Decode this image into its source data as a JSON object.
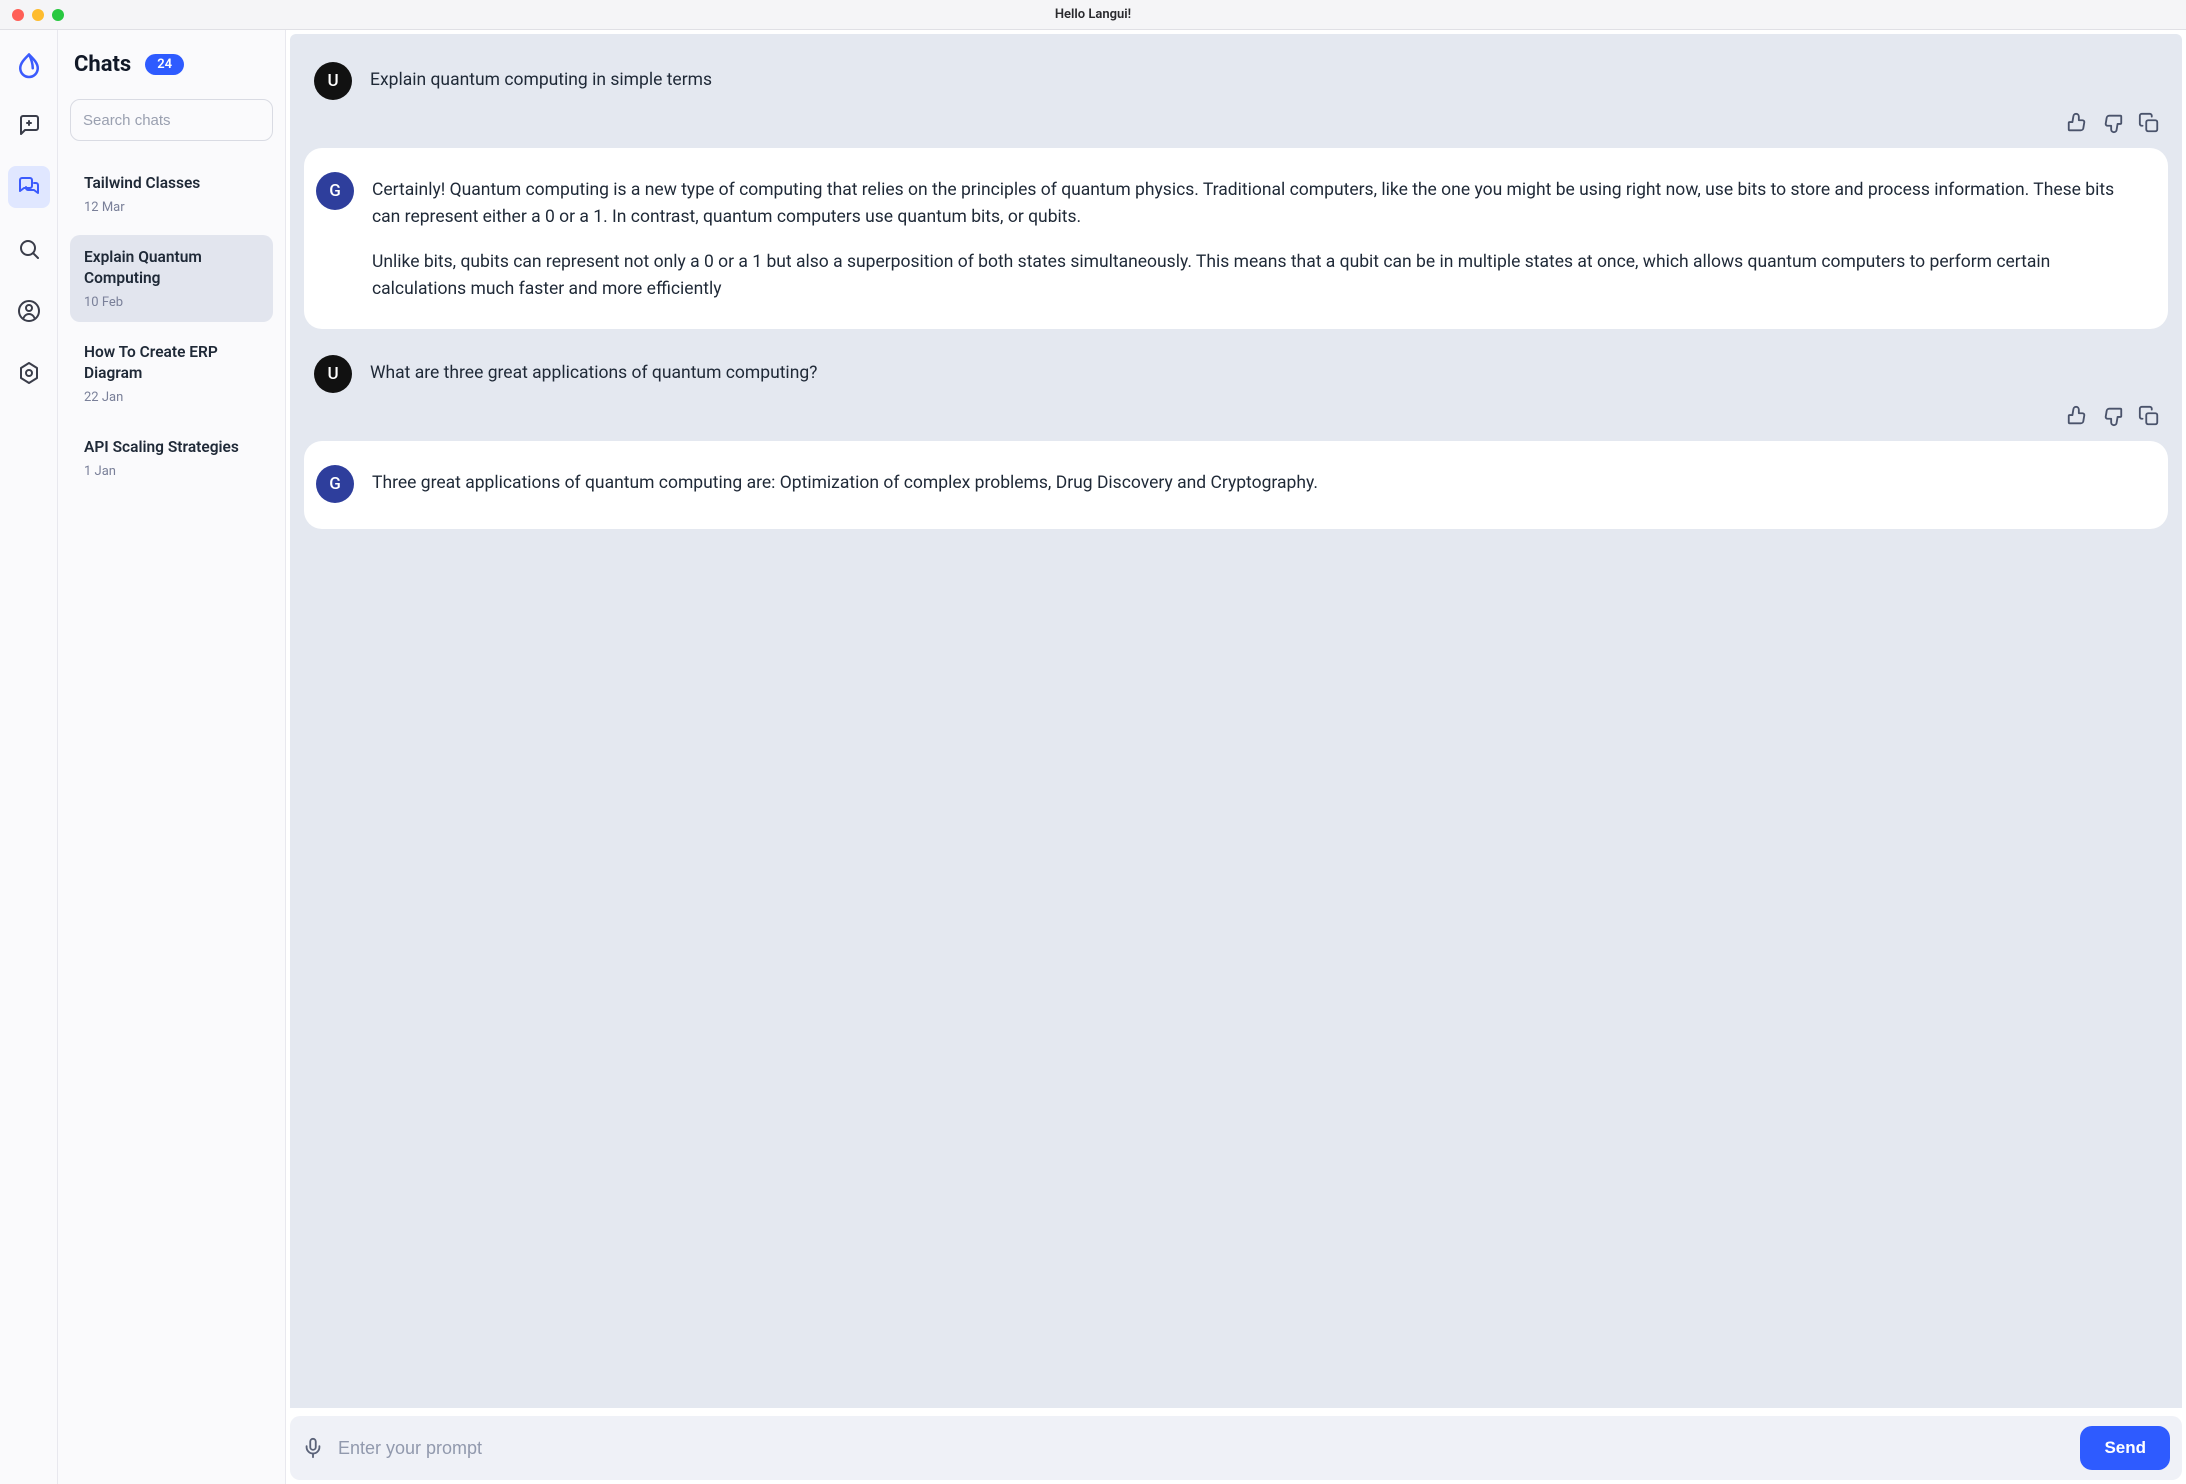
{
  "window": {
    "title": "Hello Langui!"
  },
  "sidebar": {
    "heading": "Chats",
    "badge": "24",
    "search_placeholder": "Search chats",
    "items": [
      {
        "title": "Tailwind Classes",
        "date": "12 Mar",
        "active": false
      },
      {
        "title": "Explain Quantum Computing",
        "date": "10 Feb",
        "active": true
      },
      {
        "title": "How To Create ERP Diagram",
        "date": "22 Jan",
        "active": false
      },
      {
        "title": "API Scaling Strategies",
        "date": "1 Jan",
        "active": false
      }
    ]
  },
  "conversation": [
    {
      "role": "user",
      "avatar": "U",
      "text": "Explain quantum computing in simple terms"
    },
    {
      "role": "assistant",
      "avatar": "G",
      "paragraphs": [
        "Certainly! Quantum computing is a new type of computing that relies on the principles of quantum physics. Traditional computers, like the one you might be using right now, use bits to store and process information. These bits can represent either a 0 or a 1. In contrast, quantum computers use quantum bits, or qubits.",
        "Unlike bits, qubits can represent not only a 0 or a 1 but also a superposition of both states simultaneously. This means that a qubit can be in multiple states at once, which allows quantum computers to perform certain calculations much faster and more efficiently"
      ]
    },
    {
      "role": "user",
      "avatar": "U",
      "text": "What are three great applications of quantum computing?"
    },
    {
      "role": "assistant",
      "avatar": "G",
      "paragraphs": [
        "Three great applications of quantum computing are: Optimization of complex problems, Drug Discovery and Cryptography."
      ]
    }
  ],
  "composer": {
    "placeholder": "Enter your prompt",
    "send_label": "Send"
  }
}
